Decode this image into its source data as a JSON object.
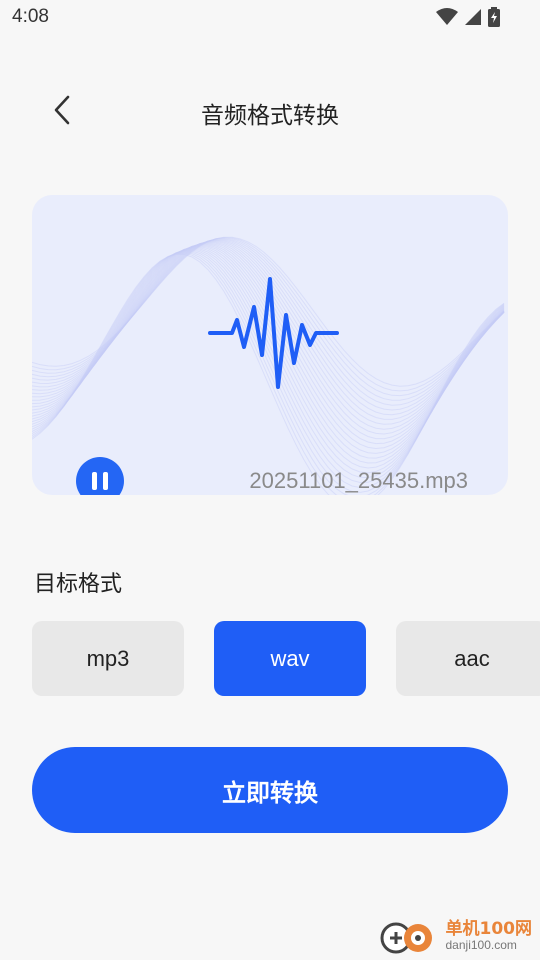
{
  "status": {
    "time": "4:08"
  },
  "header": {
    "title": "音频格式转换"
  },
  "player": {
    "filename": "20251101_25435.mp3"
  },
  "target": {
    "label": "目标格式",
    "formats": [
      "mp3",
      "wav",
      "aac"
    ],
    "selected": "wav"
  },
  "actions": {
    "convert": "立即转换"
  },
  "watermark": {
    "name": "单机100网",
    "site": "danji100.com"
  },
  "colors": {
    "accent": "#1f5ef6",
    "card": "#e9edfc",
    "unselected": "#e8e8e8"
  }
}
